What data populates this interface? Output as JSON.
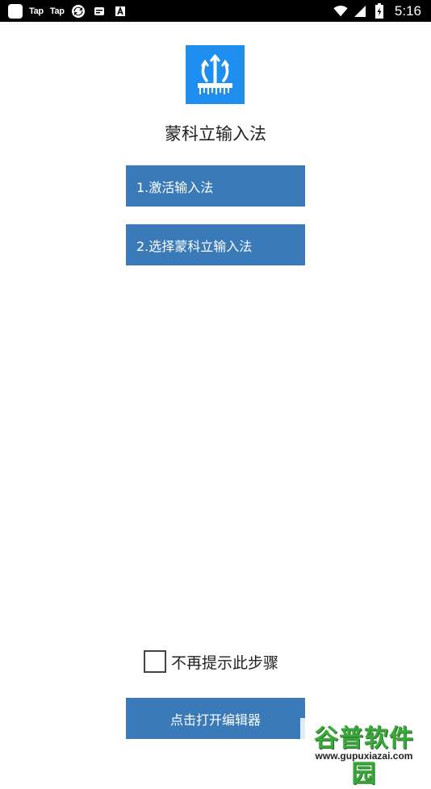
{
  "status_bar": {
    "tap_label_1": "Tap",
    "tap_label_2": "Tap",
    "time": "5:16",
    "battery_level": "charging",
    "icons": [
      "app-square-icon",
      "tap-tap-icon",
      "tap-tap-icon",
      "sync-icon",
      "message-icon",
      "a-letter-icon",
      "wifi-icon",
      "signal-icon",
      "battery-icon"
    ]
  },
  "app": {
    "logo_icon": "trident-ruler-logo",
    "logo_color": "#1e8ff0",
    "title": "蒙科立输入法"
  },
  "steps": {
    "step1_label": "1.激活输入法",
    "step2_label": "2.选择蒙科立输入法",
    "button_color": "#3a7ab8"
  },
  "dont_remind": {
    "checked": false,
    "label": "不再提示此步骤"
  },
  "open_editor": {
    "label": "点击打开编辑器"
  },
  "watermark": {
    "title": "谷普软件园",
    "url": "www.gupuxiazai.com"
  }
}
